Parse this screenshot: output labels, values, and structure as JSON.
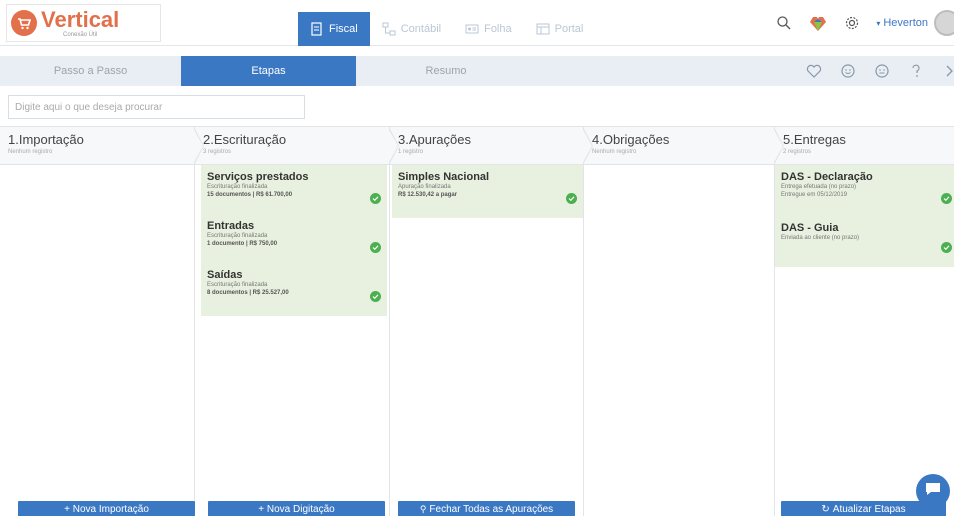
{
  "brand": {
    "name": "Vertical",
    "tagline": "Conexão Útil",
    "color": "#e2704a"
  },
  "modules": [
    {
      "label": "Fiscal",
      "icon": "document-icon",
      "active": true
    },
    {
      "label": "Contábil",
      "icon": "org-chart-icon",
      "active": false
    },
    {
      "label": "Folha",
      "icon": "id-card-icon",
      "active": false
    },
    {
      "label": "Portal",
      "icon": "portal-icon",
      "active": false
    }
  ],
  "user": {
    "name": "Heverton"
  },
  "subnav": {
    "tabs": [
      {
        "label": "Passo a Passo",
        "active": false
      },
      {
        "label": "Etapas",
        "active": true
      },
      {
        "label": "Resumo",
        "active": false
      }
    ]
  },
  "search": {
    "placeholder": "Digite aqui o que deseja procurar"
  },
  "columns": [
    {
      "title": "1.Importação",
      "subtitle": "Nenhum registro",
      "button": "+ Nova Importação",
      "cards": []
    },
    {
      "title": "2.Escrituração",
      "subtitle": "3 registros",
      "button": "+ Nova Digitação",
      "cards": [
        {
          "title": "Serviços prestados",
          "status": "Escrituração finalizada",
          "detail": "15 documentos | R$ 61.700,00"
        },
        {
          "title": "Entradas",
          "status": "Escrituração finalizada",
          "detail": "1 documento | R$ 750,00"
        },
        {
          "title": "Saídas",
          "status": "Escrituração finalizada",
          "detail": "8 documentos | R$ 25.527,00"
        }
      ]
    },
    {
      "title": "3.Apurações",
      "subtitle": "1 registro",
      "button": "Fechar Todas as Apurações",
      "cards": [
        {
          "title": "Simples Nacional",
          "status": "Apuração finalizada",
          "detail": "R$ 12.530,42 a pagar"
        }
      ]
    },
    {
      "title": "4.Obrigações",
      "subtitle": "Nenhum registro",
      "button": "",
      "cards": []
    },
    {
      "title": "5.Entregas",
      "subtitle": "2 registros",
      "button": "Atualizar Etapas",
      "cards": [
        {
          "title": "DAS - Declaração",
          "status": "Entrega efetuada (no prazo)",
          "detail": "Entregue em 05/12/2019"
        },
        {
          "title": "DAS - Guia",
          "status": "Enviada ao cliente (no prazo)",
          "detail": ""
        }
      ]
    }
  ],
  "colors": {
    "accent": "#3b78c4",
    "card_bg": "#e8f1df",
    "success": "#4caf50"
  }
}
